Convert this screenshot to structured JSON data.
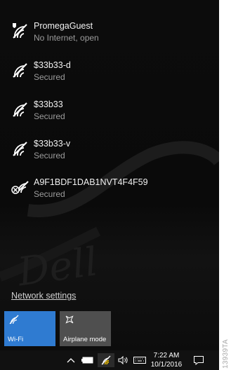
{
  "networks": [
    {
      "name": "PromegaGuest",
      "status": "No Internet, open",
      "icon": "wifi-shield-icon"
    },
    {
      "name": "$33b33-d",
      "status": "Secured",
      "icon": "wifi-secured-icon"
    },
    {
      "name": "$33b33",
      "status": "Secured",
      "icon": "wifi-secured-icon"
    },
    {
      "name": "$33b33-v",
      "status": "Secured",
      "icon": "wifi-secured-icon"
    },
    {
      "name": "A9F1BDF1DAB1NVT4F4F59",
      "status": "Secured",
      "icon": "wifi-no-access-icon"
    }
  ],
  "settings_link": "Network settings",
  "quick_actions": {
    "wifi_label": "Wi-Fi",
    "airplane_label": "Airplane mode",
    "wifi_color": "#2f7bd1",
    "airplane_color": "#4f4f4f"
  },
  "taskbar": {
    "time": "7:22 AM",
    "date": "10/1/2016",
    "icons": [
      "chevron-up-icon",
      "battery-icon",
      "wifi-icon",
      "volume-icon",
      "keyboard-icon",
      "action-center-icon"
    ]
  },
  "watermark": "13939TA",
  "background_text": "Dell"
}
